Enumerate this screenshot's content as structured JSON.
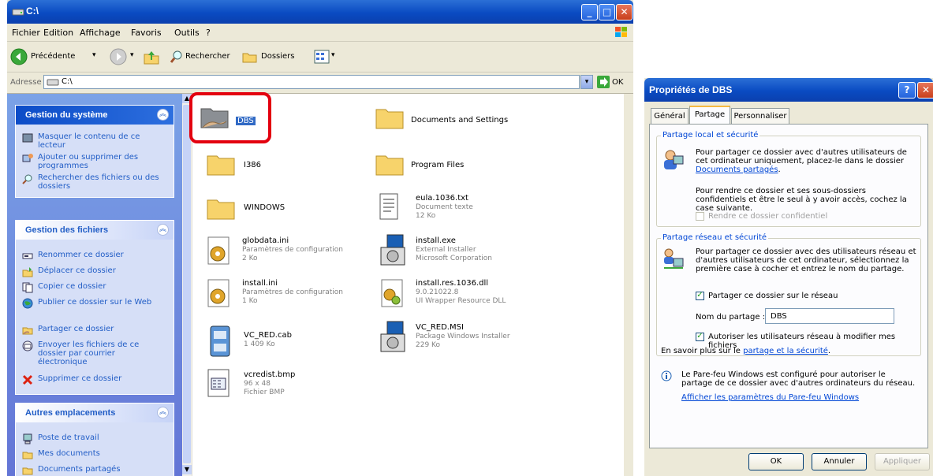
{
  "explorer": {
    "title": "C:\\",
    "menu": [
      "Fichier",
      "Edition",
      "Affichage",
      "Favoris",
      "Outils",
      "?"
    ],
    "toolbar": {
      "back_label": "Précédente",
      "search_label": "Rechercher",
      "folders_label": "Dossiers"
    },
    "address": {
      "label": "Adresse",
      "value": "C:\\",
      "go_label": "OK"
    },
    "task_panels": {
      "system": {
        "title": "Gestion du système",
        "items": [
          "Masquer le contenu de ce lecteur",
          "Ajouter ou supprimer des programmes",
          "Rechercher des fichiers ou des dossiers"
        ]
      },
      "files": {
        "title": "Gestion des fichiers",
        "items": [
          "Renommer ce dossier",
          "Déplacer ce dossier",
          "Copier ce dossier",
          "Publier ce dossier sur le Web",
          "Partager ce dossier",
          "Envoyer les fichiers de ce dossier par courrier électronique",
          "Supprimer ce dossier"
        ]
      },
      "places": {
        "title": "Autres emplacements",
        "items": [
          "Poste de travail",
          "Mes documents",
          "Documents partagés"
        ]
      }
    },
    "files": [
      {
        "name": "DBS",
        "l1": "",
        "l2": ""
      },
      {
        "name": "Documents and Settings",
        "l1": "",
        "l2": ""
      },
      {
        "name": "I386",
        "l1": "",
        "l2": ""
      },
      {
        "name": "Program Files",
        "l1": "",
        "l2": ""
      },
      {
        "name": "WINDOWS",
        "l1": "",
        "l2": ""
      },
      {
        "name": "eula.1036.txt",
        "l1": "Document texte",
        "l2": "12 Ko"
      },
      {
        "name": "globdata.ini",
        "l1": "Paramètres de configuration",
        "l2": "2 Ko"
      },
      {
        "name": "install.exe",
        "l1": "External Installer",
        "l2": "Microsoft Corporation"
      },
      {
        "name": "install.ini",
        "l1": "Paramètres de configuration",
        "l2": "1 Ko"
      },
      {
        "name": "install.res.1036.dll",
        "l1": "9.0.21022.8",
        "l2": "UI Wrapper Resource DLL"
      },
      {
        "name": "VC_RED.cab",
        "l1": "1 409 Ko",
        "l2": ""
      },
      {
        "name": "VC_RED.MSI",
        "l1": "Package Windows Installer",
        "l2": "229 Ko"
      },
      {
        "name": "vcredist.bmp",
        "l1": "96 x 48",
        "l2": "Fichier BMP"
      }
    ]
  },
  "dialog": {
    "title": "Propriétés de DBS",
    "tabs": [
      "Général",
      "Partage",
      "Personnaliser"
    ],
    "local": {
      "legend": "Partage local et sécurité",
      "p1": "Pour partager ce dossier avec d'autres utilisateurs de cet ordinateur uniquement, placez-le dans le dossier",
      "p1_link": "Documents partagés",
      "p2": "Pour rendre ce dossier et ses sous-dossiers confidentiels et être le seul à y avoir accès, cochez la case suivante.",
      "private_label": "Rendre ce dossier confidentiel"
    },
    "network": {
      "legend": "Partage réseau et sécurité",
      "p1": "Pour partager ce dossier avec des utilisateurs réseau et d'autres utilisateurs de cet ordinateur, sélectionnez la première case à cocher et entrez le nom du partage.",
      "share_label": "Partager ce dossier sur le réseau",
      "sharename_label": "Nom du partage :",
      "sharename_value": "DBS",
      "allow_label": "Autoriser les utilisateurs réseau à modifier mes fichiers",
      "learn_prefix": "En savoir plus sur le",
      "learn_link": "partage et la sécurité"
    },
    "firewall": {
      "text": "Le Pare-feu Windows est configuré pour autoriser le partage de ce dossier avec d'autres ordinateurs du réseau.",
      "link": "Afficher les paramètres du Pare-feu Windows"
    },
    "buttons": {
      "ok": "OK",
      "cancel": "Annuler",
      "apply": "Appliquer"
    }
  }
}
